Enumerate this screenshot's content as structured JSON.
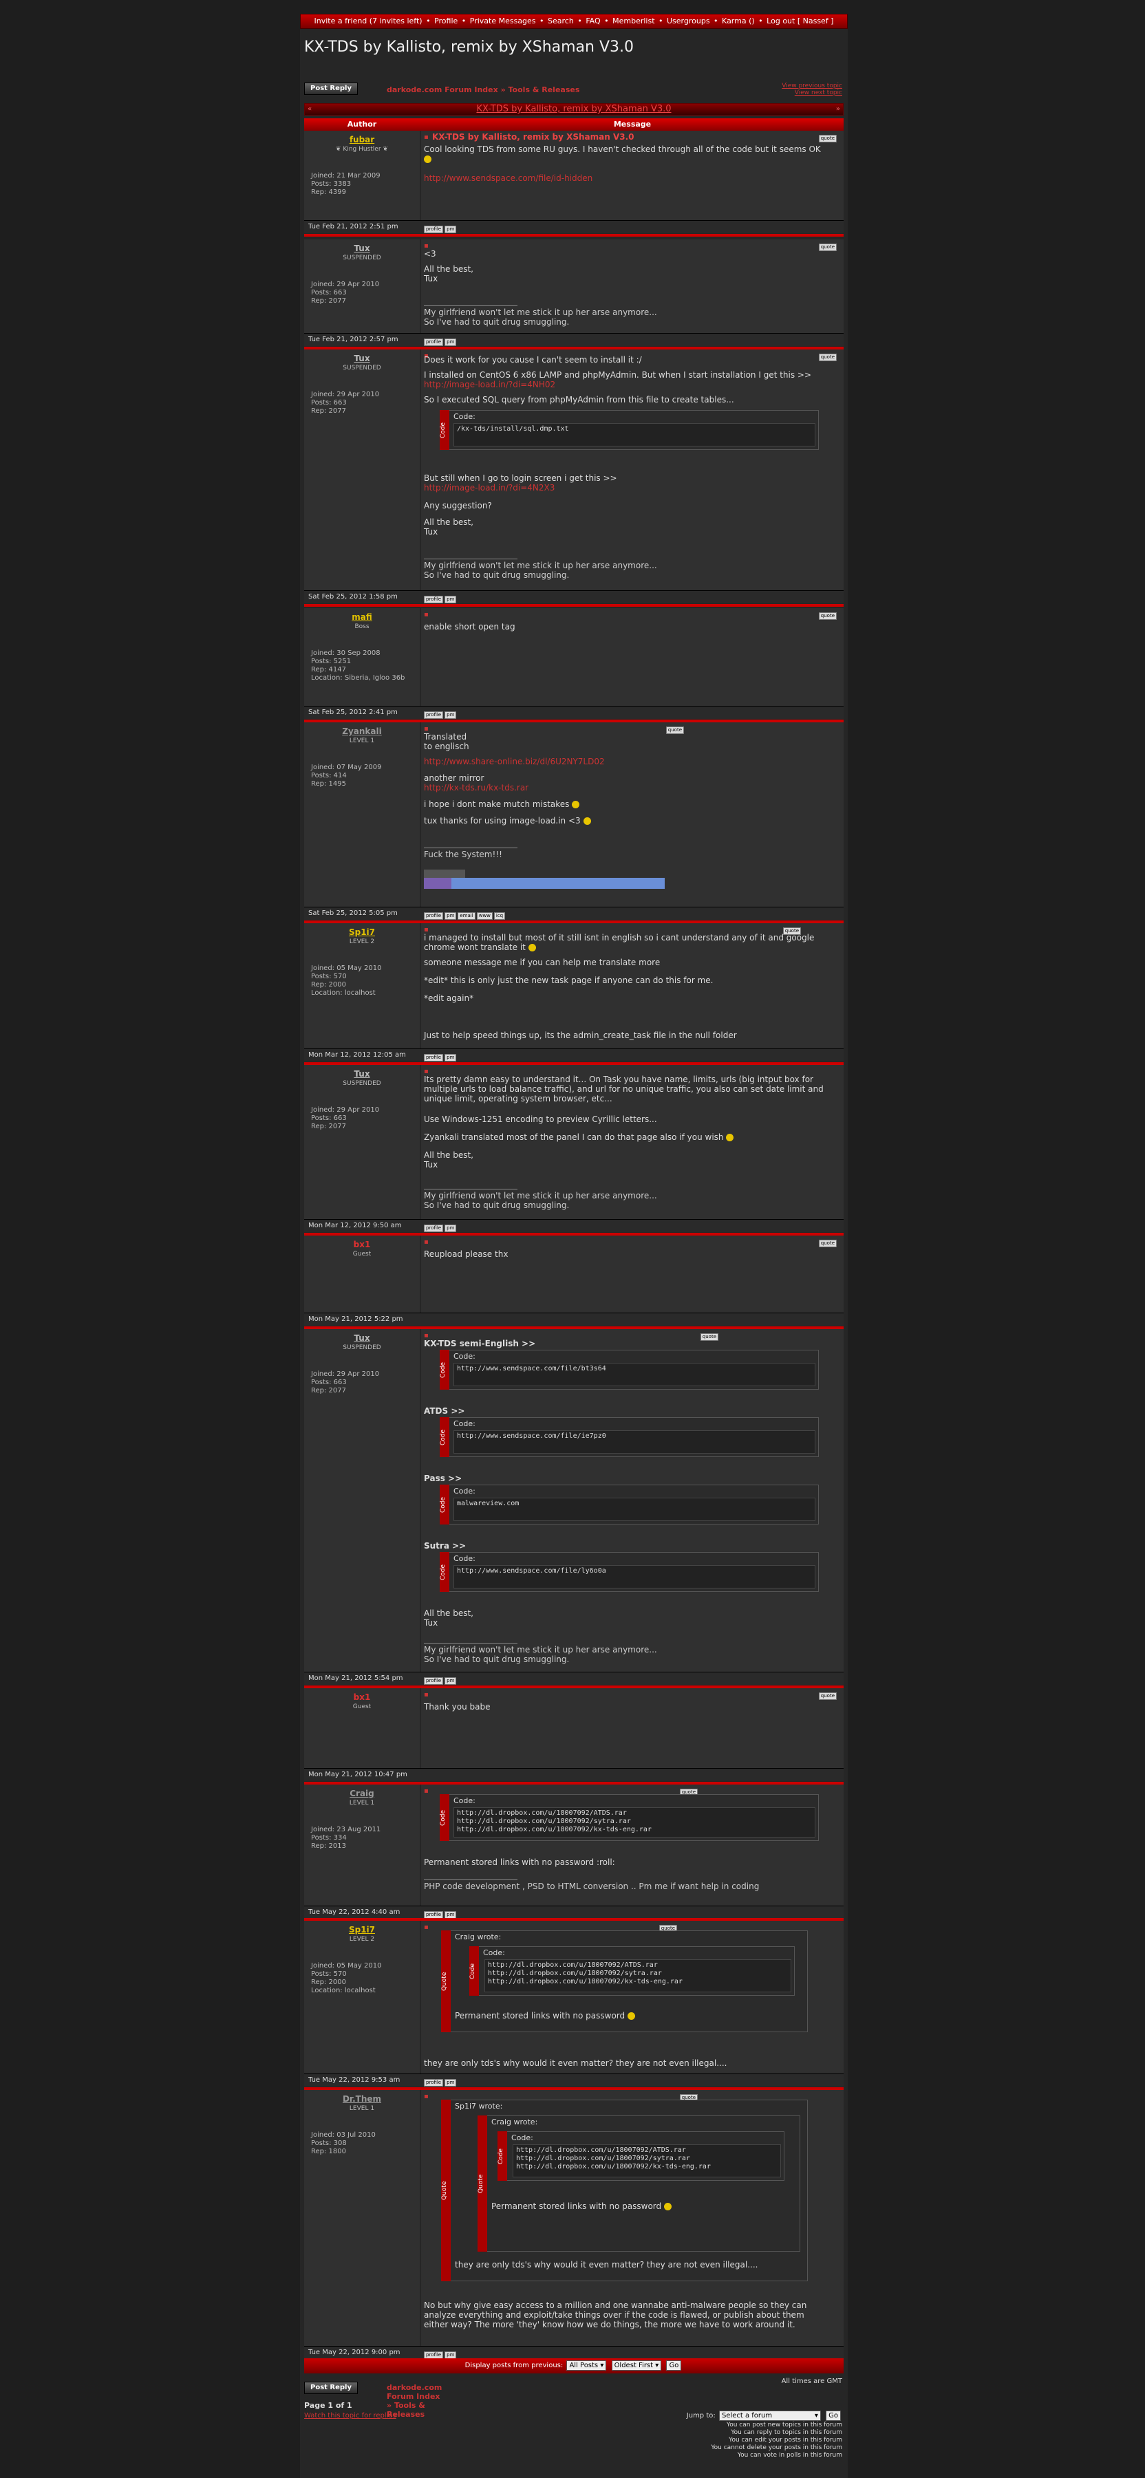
{
  "topbar": {
    "items": [
      "Invite a friend (7 invites left)",
      "Profile",
      "Private Messages",
      "Search",
      "FAQ",
      "Memberlist",
      "Usergroups",
      "Karma ()",
      "Log out [ Nassef ]"
    ]
  },
  "page": {
    "title": "KX-TDS by Kallisto, remix by XShaman V3.0"
  },
  "nav": {
    "post_reply": "Post Reply",
    "forum_index": "darkode.com Forum Index",
    "sep": "»",
    "section": "Tools & Releases",
    "prev_topic": "View previous topic",
    "next_topic": "View next topic"
  },
  "thread": {
    "title": "KX-TDS by Kallisto, remix by XShaman V3.0",
    "prev": "«",
    "next": "»"
  },
  "columns": {
    "author": "Author",
    "message": "Message"
  },
  "labels": {
    "quote": "quote",
    "profile": "profile",
    "pm": "pm",
    "email": "email",
    "www": "www",
    "code": "Code:",
    "code_tab": "Code",
    "quote_tab": "Quote"
  },
  "posts": [
    {
      "author": "fubar",
      "rank": "❦ King Hustler ❦",
      "stats": "Joined: 21 Mar 2009\nPosts: 3383\nRep: 4399",
      "title": "KX-TDS by Kallisto, remix by XShaman V3.0",
      "text": "Cool looking TDS from some RU guys. I haven't checked through all of the code but it seems OK",
      "link": "http://www.sendspace.com/file/id-hidden",
      "date": "Tue Feb 21, 2012 2:51 pm"
    },
    {
      "author": "Tux",
      "rank": "SUSPENDED",
      "stats": "Joined: 29 Apr 2010\nPosts: 663\nRep: 2077",
      "text": "<3",
      "text2": "All the best,",
      "text3": "Tux",
      "sig1": "My girlfriend won't let me stick it up her arse anymore...",
      "sig2": "So I've had to quit drug smuggling.",
      "date": "Tue Feb 21, 2012 2:57 pm"
    },
    {
      "author": "Tux",
      "rank": "SUSPENDED",
      "stats": "Joined: 29 Apr 2010\nPosts: 663\nRep: 2077",
      "l1": "Does it work for you cause I can't seem to install it :/",
      "l2": "I installed on CentOS 6 x86 LAMP and phpMyAdmin. But when I start installation I get this >>",
      "link1": "http://image-load.in/?di=4NH02",
      "l3": "So I executed SQL query from phpMyAdmin from this file to create tables...",
      "code": "/kx-tds/install/sql.dmp.txt",
      "l4": "But still when I go to login screen i get this >>",
      "link2": "http://image-load.in/?di=4N2X3",
      "l5": "Any suggestion?",
      "l6": "All the best,",
      "l7": "Tux",
      "date": "Sat Feb 25, 2012 1:58 pm"
    },
    {
      "author": "mafi",
      "rank": "Boss",
      "stats": "Joined: 30 Sep 2008\nPosts: 5251\nRep: 4147\nLocation: Siberia, Igloo 36b",
      "text": "enable short open tag",
      "date": "Sat Feb 25, 2012 2:41 pm"
    },
    {
      "author": "Zyankali",
      "rank": "LEVEL 1",
      "stats": "Joined: 07 May 2009\nPosts: 414\nRep: 1495",
      "l1": "Translated",
      "l2": "to englisch",
      "link1": "http://www.share-online.biz/dl/6U2NY7LD02",
      "l3": "another mirror",
      "link2": "http://kx-tds.ru/kx-tds.rar",
      "l4": "i hope i dont make mutch mistakes",
      "l5": "tux thanks for using image-load.in <3",
      "sig": "Fuck the System!!!",
      "date": "Sat Feb 25, 2012 5:05 pm"
    },
    {
      "author": "Sp1i7",
      "rank": "LEVEL 2",
      "stats": "Joined: 05 May 2010\nPosts: 570\nRep: 2000\nLocation: localhost",
      "l1": "i managed to install but most of it still isnt in english so i cant understand any of it and google chrome wont translate it",
      "l2": "someone message me if you can help me translate more",
      "l3": "*edit* this is only just the new task page if anyone can do this for me.",
      "l4": "*edit again*",
      "l5": "Just to help speed things up, its the admin_create_task file in the null folder",
      "date": "Mon Mar 12, 2012 12:05 am"
    },
    {
      "author": "Tux",
      "rank": "SUSPENDED",
      "stats": "Joined: 29 Apr 2010\nPosts: 663\nRep: 2077",
      "l1": "Its pretty damn easy to understand it... On Task you have name, limits, urls (big intput box for multiple urls to load balance traffic), and url for no unique traffic, you also can set date limit and unique limit, operating system browser, etc...",
      "l2": "Use Windows-1251 encoding to preview Cyrillic letters...",
      "l3": "Zyankali translated most of the panel I can do that page also if you wish",
      "l4": "All the best,",
      "l5": "Tux",
      "date": "Mon Mar 12, 2012 9:50 am"
    },
    {
      "author": "bx1",
      "rank": "Guest",
      "text": "Reupload please thx",
      "date": "Mon May 21, 2012 5:22 pm"
    },
    {
      "author": "Tux",
      "rank": "SUSPENDED",
      "stats": "Joined: 29 Apr 2010\nPosts: 663\nRep: 2077",
      "h1": "KX-TDS semi-English >>",
      "c1": "http://www.sendspace.com/file/bt3s64",
      "h2": "ATDS >>",
      "c2": "http://www.sendspace.com/file/ie7pz0",
      "h3": "Pass >>",
      "c3": "malwareview.com",
      "h4": "Sutra >>",
      "c4": "http://www.sendspace.com/file/ly6o0a",
      "l1": "All the best,",
      "l2": "Tux",
      "date": "Mon May 21, 2012 5:54 pm"
    },
    {
      "author": "bx1",
      "rank": "Guest",
      "text": "Thank you babe",
      "date": "Mon May 21, 2012 10:47 pm"
    },
    {
      "author": "Craig",
      "rank": "LEVEL 1",
      "stats": "Joined: 23 Aug 2011\nPosts: 334\nRep: 2013",
      "code": "http://dl.dropbox.com/u/18007092/ATDS.rar\nhttp://dl.dropbox.com/u/18007092/sytra.rar\nhttp://dl.dropbox.com/u/18007092/kx-tds-eng.rar",
      "l1": "Permanent stored links with no password :roll:",
      "sig": "PHP code development , PSD to HTML conversion .. Pm me if want help in coding",
      "date": "Tue May 22, 2012 4:40 am"
    },
    {
      "author": "Sp1i7",
      "rank": "LEVEL 2",
      "stats": "Joined: 05 May 2010\nPosts: 570\nRep: 2000\nLocation: localhost",
      "qhead": "Craig wrote:",
      "code": "http://dl.dropbox.com/u/18007092/ATDS.rar\nhttp://dl.dropbox.com/u/18007092/sytra.rar\nhttp://dl.dropbox.com/u/18007092/kx-tds-eng.rar",
      "qtext": "Permanent stored links with no password",
      "l1": "they are only tds's why would it even matter? they are not even illegal....",
      "date": "Tue May 22, 2012 9:53 am"
    },
    {
      "author": "Dr.Them",
      "rank": "LEVEL 1",
      "stats": "Joined: 03 Jul 2010\nPosts: 308\nRep: 1800",
      "qhead": "Sp1i7 wrote:",
      "qhead2": "Craig wrote:",
      "code": "http://dl.dropbox.com/u/18007092/ATDS.rar\nhttp://dl.dropbox.com/u/18007092/sytra.rar\nhttp://dl.dropbox.com/u/18007092/kx-tds-eng.rar",
      "qtext2": "Permanent stored links with no password",
      "qtext": "they are only tds's why would it even matter? they are not even illegal....",
      "l1": "No but why give easy access to a million and one wannabe anti-malware people so they can analyze everything and exploit/take things over if the code is flawed, or publish about them either way? The more 'they' know how we do things, the more we have to work around it.",
      "date": "Tue May 22, 2012 9:00 pm"
    }
  ],
  "footbar": {
    "display": "Display posts from previous:",
    "all_posts": "All Posts",
    "oldest": "Oldest First",
    "go": "Go"
  },
  "bottom": {
    "all_times": "All times are GMT",
    "page_of": "Page 1 of 1",
    "watch": "Watch this topic for replies",
    "jump_to": "Jump to:",
    "select_forum": "Select a forum",
    "go": "Go",
    "perms": [
      "You can post new topics in this forum",
      "You can reply to topics in this forum",
      "You can edit your posts in this forum",
      "You cannot delete your posts in this forum",
      "You can vote in polls in this forum"
    ]
  },
  "colors": {
    "accent": "#cc0000",
    "bg": "#262626",
    "link": "#cc3333"
  }
}
